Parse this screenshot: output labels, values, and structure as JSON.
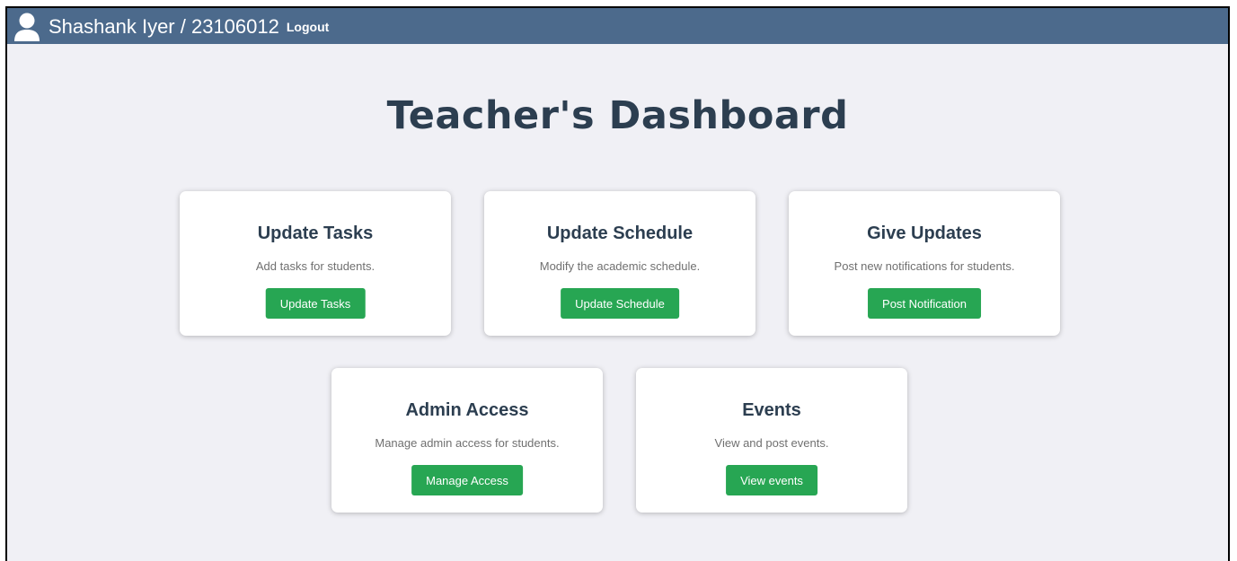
{
  "header": {
    "user_label": "Shashank Iyer / 23106012",
    "logout_label": "Logout",
    "icon": "user-icon"
  },
  "page": {
    "title": "Teacher's Dashboard"
  },
  "cards": [
    {
      "title": "Update Tasks",
      "description": "Add tasks for students.",
      "button_label": "Update Tasks"
    },
    {
      "title": "Update Schedule",
      "description": "Modify the academic schedule.",
      "button_label": "Update Schedule"
    },
    {
      "title": "Give Updates",
      "description": "Post new notifications for students.",
      "button_label": "Post Notification"
    },
    {
      "title": "Admin Access",
      "description": "Manage admin access for students.",
      "button_label": "Manage Access"
    },
    {
      "title": "Events",
      "description": "View and post events.",
      "button_label": "View events"
    }
  ],
  "colors": {
    "header_bg": "#4c6a8c",
    "page_bg": "#f0f0f5",
    "title_text": "#2c3e50",
    "button_bg": "#27a653"
  }
}
